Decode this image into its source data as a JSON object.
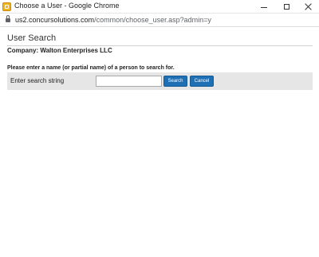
{
  "window": {
    "title": "Choose a User - Google Chrome"
  },
  "address": {
    "host": "us2.concursolutions.com",
    "path": "/common/choose_user.asp?admin=y"
  },
  "page": {
    "title": "User Search",
    "company": "Company: Walton Enterprises LLC",
    "instructions": "Please enter a name (or partial name) of a person to search for."
  },
  "search": {
    "label": "Enter search string",
    "value": "",
    "placeholder": "",
    "search_button": "Search",
    "cancel_button": "Cancel"
  },
  "colors": {
    "button": "#1f6fb5",
    "row_background": "#e6e6e6",
    "app_icon": "#f2b418"
  },
  "icons": [
    "concur-app-icon",
    "minimize-icon",
    "maximize-icon",
    "close-icon",
    "lock-icon"
  ]
}
